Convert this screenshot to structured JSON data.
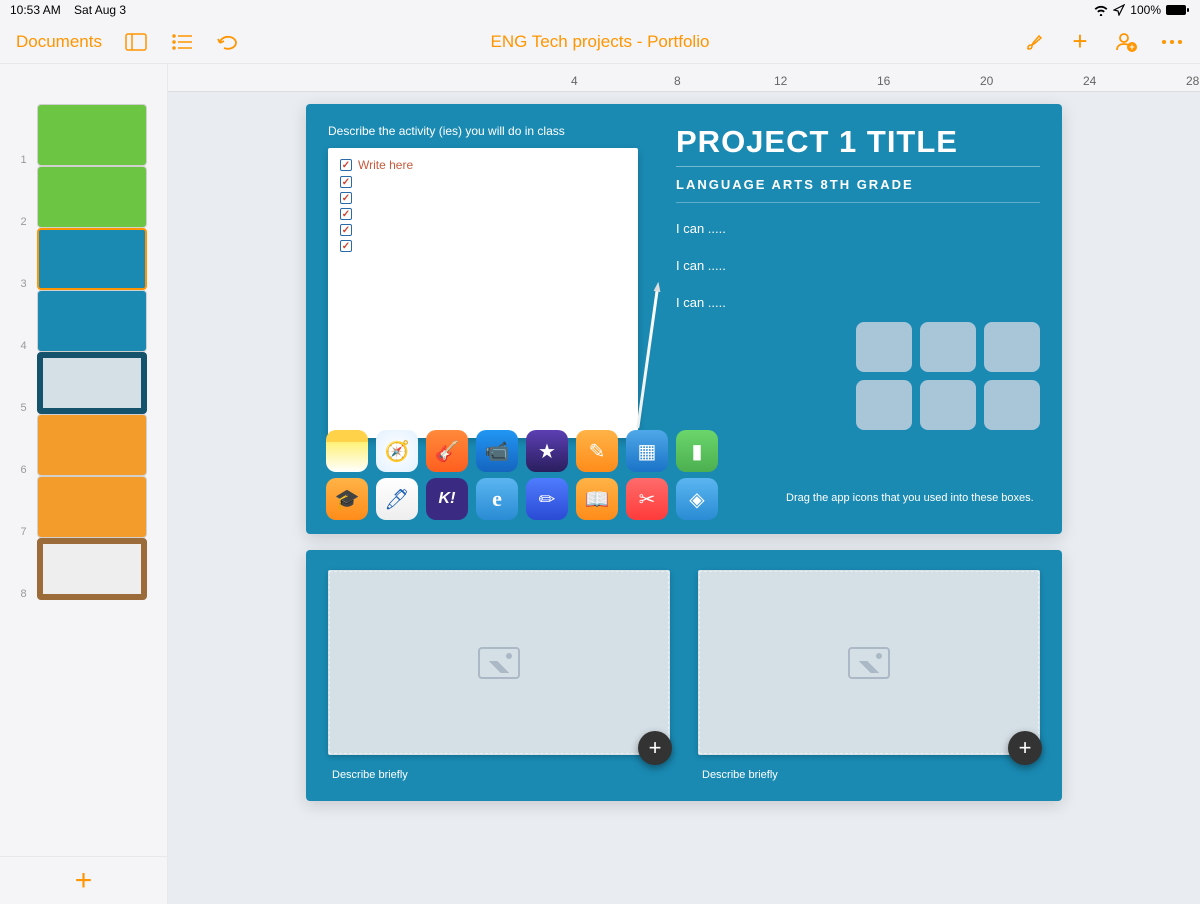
{
  "status": {
    "time": "10:53 AM",
    "date": "Sat Aug 3",
    "battery": "100%"
  },
  "toolbar": {
    "documents": "Documents",
    "title": "ENG Tech projects - Portfolio"
  },
  "ruler": {
    "marks": [
      "4",
      "8",
      "12",
      "16",
      "20",
      "24",
      "28"
    ]
  },
  "sidebar": {
    "thumbs": [
      {
        "n": "1",
        "cls": "green"
      },
      {
        "n": "2",
        "cls": "green"
      },
      {
        "n": "3",
        "cls": "teal selected"
      },
      {
        "n": "4",
        "cls": "teal"
      },
      {
        "n": "5",
        "cls": "darkteal"
      },
      {
        "n": "6",
        "cls": "orange"
      },
      {
        "n": "7",
        "cls": "orange"
      },
      {
        "n": "8",
        "cls": "brown"
      }
    ]
  },
  "slide": {
    "describe": "Describe the activity (ies) you will do in class",
    "write_here": "Write here",
    "title": "PROJECT 1 TITLE",
    "subtitle": "LANGUAGE ARTS 8TH GRADE",
    "ican1": "I can .....",
    "ican2": "I can .....",
    "ican3": "I can .....",
    "drag_label": "Drag the app icons that you used into these boxes.",
    "caption1": "Describe briefly",
    "caption2": "Describe briefly"
  },
  "apps_row1": [
    {
      "name": "notes",
      "bg": "linear-gradient(#fff176,#fff)",
      "glyph": ""
    },
    {
      "name": "safari",
      "bg": "radial-gradient(#fff,#e3f1ff)",
      "glyph": "🧭"
    },
    {
      "name": "garageband",
      "bg": "linear-gradient(#ff8a3c,#ff5e1f)",
      "glyph": "🎸"
    },
    {
      "name": "clips",
      "bg": "linear-gradient(#2196f3,#1565c0)",
      "glyph": "📹"
    },
    {
      "name": "imovie",
      "bg": "linear-gradient(#5c3fb3,#2a1e5e)",
      "glyph": "★"
    },
    {
      "name": "pages",
      "bg": "linear-gradient(#ffb347,#ff8c1a)",
      "glyph": "✎"
    },
    {
      "name": "keynote",
      "bg": "linear-gradient(#4fa8e8,#1a73c7)",
      "glyph": "▦"
    },
    {
      "name": "numbers",
      "bg": "linear-gradient(#6bd66b,#4caf50)",
      "glyph": "▮"
    }
  ],
  "apps_row2": [
    {
      "name": "itunes-u",
      "bg": "linear-gradient(#ffb347,#ff8c1a)",
      "glyph": "🎓"
    },
    {
      "name": "sketches",
      "bg": "linear-gradient(#fff,#eee)",
      "glyph": "🖊"
    },
    {
      "name": "kahoot",
      "bg": "#3b2a82",
      "glyph": "K!"
    },
    {
      "name": "edmodo",
      "bg": "linear-gradient(#5bb5f0,#2a8cd4)",
      "glyph": "e"
    },
    {
      "name": "notability",
      "bg": "linear-gradient(#4f7cff,#2a4bd4)",
      "glyph": "✏"
    },
    {
      "name": "ibooks",
      "bg": "linear-gradient(#ffb347,#ff8c1a)",
      "glyph": "📖"
    },
    {
      "name": "screenshot",
      "bg": "linear-gradient(#ff6b6b,#ff3b3b)",
      "glyph": "✂"
    },
    {
      "name": "app",
      "bg": "linear-gradient(#5bb5f0,#2a8cd4)",
      "glyph": "◈"
    }
  ]
}
